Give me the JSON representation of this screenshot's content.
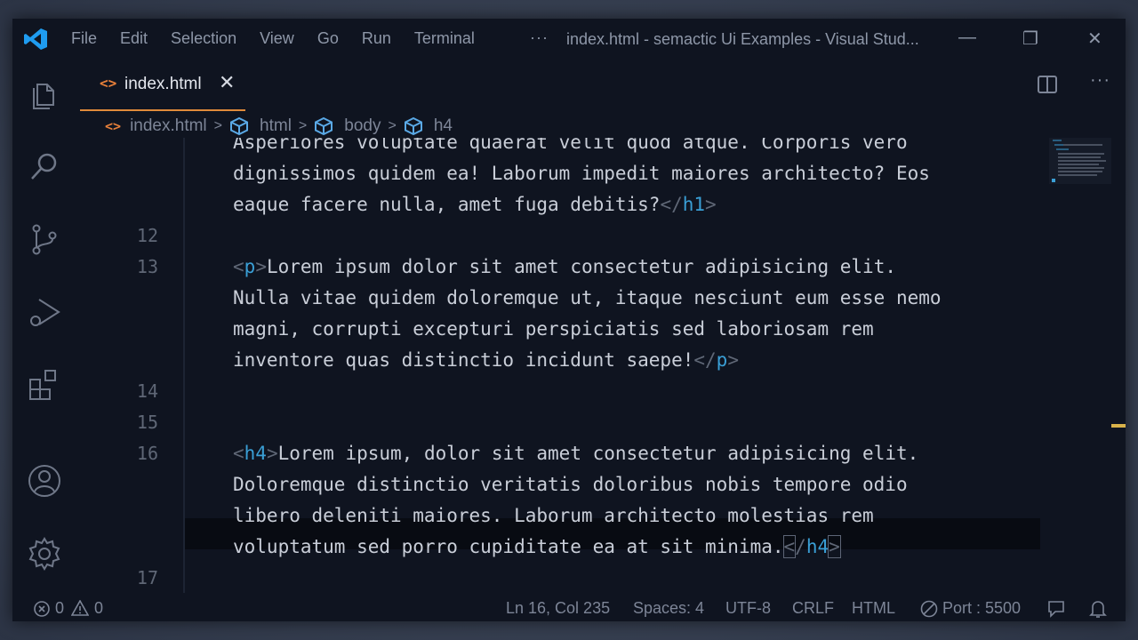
{
  "titlebar": {
    "menu": [
      "File",
      "Edit",
      "Selection",
      "View",
      "Go",
      "Run",
      "Terminal"
    ],
    "more": "···",
    "title": "index.html - semactic Ui Examples - Visual Stud...",
    "minimize": "—",
    "restore": "❐",
    "close": "✕"
  },
  "tab": {
    "icon": "<>",
    "label": "index.html",
    "close": "✕",
    "more": "···"
  },
  "breadcrumb": {
    "file_icon": "<>",
    "file": "index.html",
    "sep": ">",
    "items": [
      "html",
      "body",
      "h4"
    ]
  },
  "editor": {
    "lines": [
      {
        "num": "",
        "parts": [
          {
            "t": "Asperiores voluptate quaerat velit quod atque. Corporis vero",
            "c": "text"
          }
        ]
      },
      {
        "num": "",
        "parts": [
          {
            "t": "dignissimos quidem ea! Laborum impedit maiores architecto? Eos",
            "c": "text"
          }
        ]
      },
      {
        "num": "",
        "parts": [
          {
            "t": "eaque facere nulla, amet fuga debitis?",
            "c": "text"
          },
          {
            "t": "</",
            "c": "bracket"
          },
          {
            "t": "h1",
            "c": "tag"
          },
          {
            "t": ">",
            "c": "bracket"
          }
        ]
      },
      {
        "num": "12",
        "parts": []
      },
      {
        "num": "13",
        "parts": [
          {
            "t": "<",
            "c": "bracket"
          },
          {
            "t": "p",
            "c": "tag"
          },
          {
            "t": ">",
            "c": "bracket"
          },
          {
            "t": "Lorem ipsum dolor sit amet consectetur adipisicing elit.",
            "c": "text"
          }
        ]
      },
      {
        "num": "",
        "parts": [
          {
            "t": "Nulla vitae quidem doloremque ut, itaque nesciunt eum esse nemo",
            "c": "text"
          }
        ]
      },
      {
        "num": "",
        "parts": [
          {
            "t": "magni, corrupti excepturi perspiciatis sed laboriosam rem",
            "c": "text"
          }
        ]
      },
      {
        "num": "",
        "parts": [
          {
            "t": "inventore quas distinctio incidunt saepe!",
            "c": "text"
          },
          {
            "t": "</",
            "c": "bracket"
          },
          {
            "t": "p",
            "c": "tag"
          },
          {
            "t": ">",
            "c": "bracket"
          }
        ]
      },
      {
        "num": "14",
        "parts": []
      },
      {
        "num": "15",
        "parts": []
      },
      {
        "num": "16",
        "parts": [
          {
            "t": "<",
            "c": "bracket"
          },
          {
            "t": "h4",
            "c": "tag"
          },
          {
            "t": ">",
            "c": "bracket"
          },
          {
            "t": "Lorem ipsum, dolor sit amet consectetur adipisicing elit.",
            "c": "text"
          }
        ]
      },
      {
        "num": "",
        "parts": [
          {
            "t": "Doloremque distinctio veritatis doloribus nobis tempore odio",
            "c": "text"
          }
        ]
      },
      {
        "num": "",
        "parts": [
          {
            "t": "libero deleniti maiores. Laborum architecto molestias rem",
            "c": "text"
          }
        ]
      },
      {
        "num": "",
        "parts": [
          {
            "t": "voluptatum sed porro cupiditate ea at sit minima.",
            "c": "text"
          },
          {
            "t": "<",
            "c": "bracket box"
          },
          {
            "t": "/",
            "c": "bracket"
          },
          {
            "t": "h4",
            "c": "tag"
          },
          {
            "t": ">",
            "c": "bracket box"
          }
        ]
      },
      {
        "num": "17",
        "parts": []
      }
    ]
  },
  "statusbar": {
    "errors": "0",
    "warnings": "0",
    "position": "Ln 16, Col 235",
    "spaces": "Spaces: 4",
    "encoding": "UTF-8",
    "eol": "CRLF",
    "language": "HTML",
    "port": "Port : 5500"
  },
  "colors": {
    "accent_tab": "#e08a3a",
    "tag": "#3a9fd6",
    "text": "#c9ced8",
    "vscode_blue": "#1f9cf0"
  },
  "icons": [
    "vscode-logo-icon",
    "explorer-icon",
    "search-icon",
    "source-control-icon",
    "run-debug-icon",
    "extensions-icon",
    "account-icon",
    "settings-gear-icon",
    "split-editor-icon",
    "error-icon",
    "warning-icon",
    "port-icon",
    "feedback-icon",
    "bell-icon"
  ]
}
